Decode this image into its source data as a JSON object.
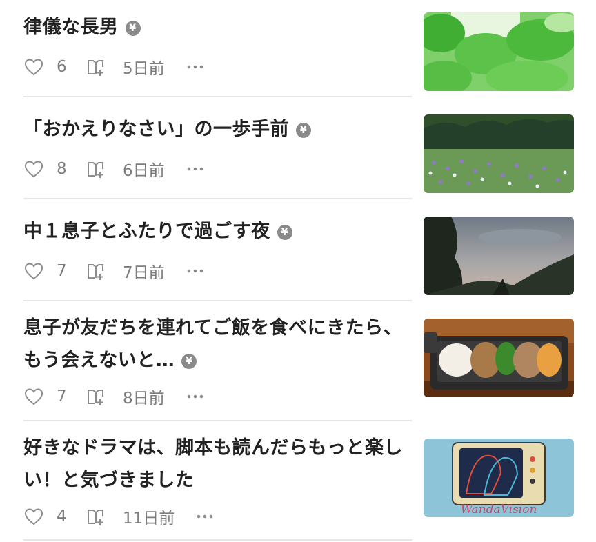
{
  "articles": [
    {
      "title": "律儀な長男",
      "paid_mark": "¥",
      "likes": "6",
      "date": "5日前"
    },
    {
      "title": "「おかえりなさい」の一歩手前",
      "paid_mark": "¥",
      "likes": "8",
      "date": "6日前"
    },
    {
      "title": "中１息子とふたりで過ごす夜",
      "paid_mark": "¥",
      "likes": "7",
      "date": "7日前"
    },
    {
      "title": "息子が友だちを連れてご飯を食べにきたら、もう会えないと…",
      "paid_mark": "¥",
      "likes": "7",
      "date": "8日前"
    },
    {
      "title": "好きなドラマは、脚本も読んだらもっと楽しい！と気づきました",
      "paid_mark": "",
      "likes": "4",
      "date": "11日前",
      "thumb_caption": "WandaVision"
    }
  ],
  "icons": {
    "like": "heart-icon",
    "save": "magazine-add-icon",
    "more": "more-dots-icon",
    "paid": "yen-icon"
  },
  "colors": {
    "text": "#222222",
    "meta": "#7d7d7d",
    "icon": "#8c8c8c",
    "divider": "#e6e6e6"
  }
}
